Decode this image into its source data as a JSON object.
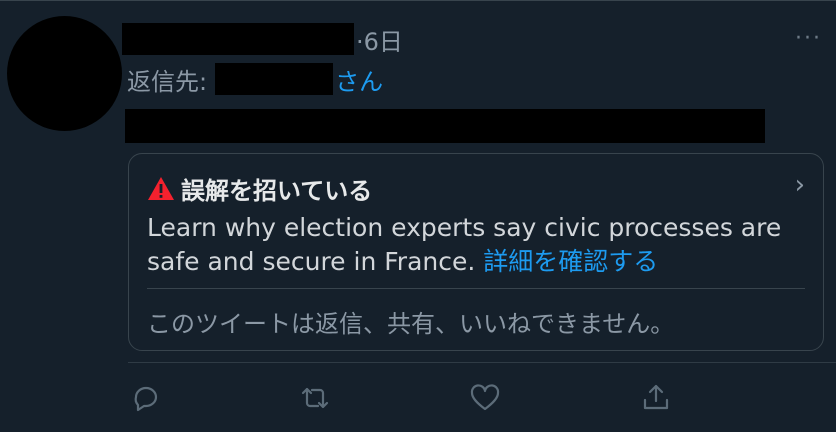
{
  "tweet": {
    "time": "·6日",
    "more_label": "···",
    "reply_prefix": "返信先:",
    "reply_suffix": "さん"
  },
  "notice": {
    "title": "誤解を招いている",
    "body": "Learn why election experts say civic processes are safe and secure in France.",
    "link": "詳細を確認する",
    "restriction": "このツイートは返信、共有、いいねできません。",
    "chevron": "›"
  },
  "colors": {
    "background": "#15202b",
    "accent": "#1d9bf0",
    "warning": "#f4212e",
    "muted": "#8b98a5"
  },
  "icons": [
    "warning-icon",
    "chevron-right-icon",
    "reply-icon",
    "retweet-icon",
    "like-icon",
    "share-icon",
    "more-icon"
  ]
}
